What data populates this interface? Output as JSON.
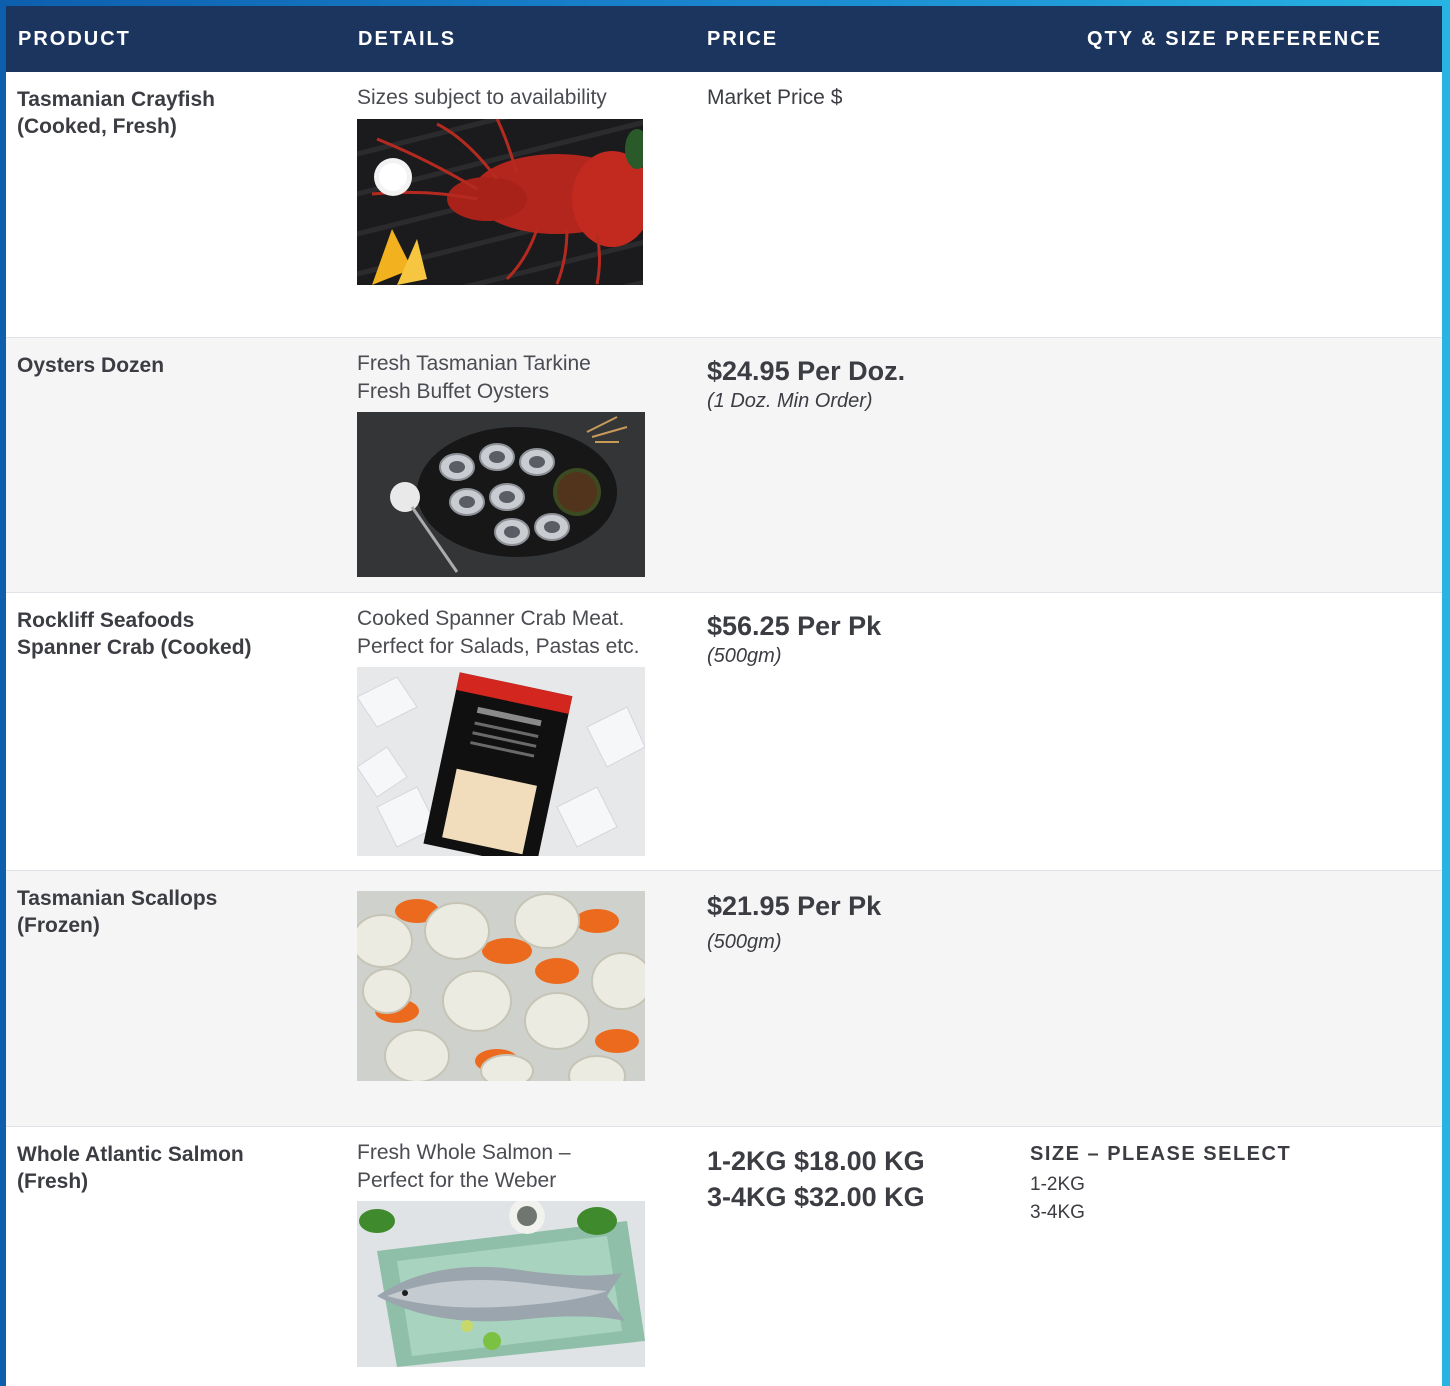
{
  "header": {
    "product": "PRODUCT",
    "details": "DETAILS",
    "price": "PRICE",
    "qty": "QTY & SIZE PREFERENCE"
  },
  "rows": [
    {
      "name_l1": "Tasmanian Crayfish",
      "name_l2": "(Cooked, Fresh)",
      "details_l1": "Sizes subject to availability",
      "price_text": "Market Price $",
      "image": "crayfish-photo"
    },
    {
      "name_l1": "Oysters Dozen",
      "details_l1": "Fresh Tasmanian Tarkine",
      "details_l2": "Fresh Buffet Oysters",
      "price_big": "$24.95 Per Doz.",
      "price_note": "(1 Doz. Min Order)",
      "image": "oysters-photo"
    },
    {
      "name_l1": "Rockliff Seafoods",
      "name_l2": "Spanner Crab (Cooked)",
      "details_l1": "Cooked Spanner Crab Meat.",
      "details_l2": "Perfect for Salads, Pastas etc.",
      "price_big": "$56.25 Per Pk",
      "price_note": "(500gm)",
      "image": "crab-meat-photo"
    },
    {
      "name_l1": "Tasmanian Scallops",
      "name_l2": "(Frozen)",
      "price_big": "$21.95 Per Pk",
      "price_note": "(500gm)",
      "image": "scallops-photo"
    },
    {
      "name_l1": "Whole Atlantic Salmon",
      "name_l2": "(Fresh)",
      "details_l1": "Fresh Whole Salmon –",
      "details_l2": "Perfect for the Weber",
      "price_big_l1": "1-2KG $18.00 KG",
      "price_big_l2": "3-4KG $32.00 KG",
      "size_label": "SIZE – PLEASE SELECT",
      "size_options": [
        "1-2KG",
        "3-4KG"
      ],
      "image": "salmon-photo"
    }
  ]
}
